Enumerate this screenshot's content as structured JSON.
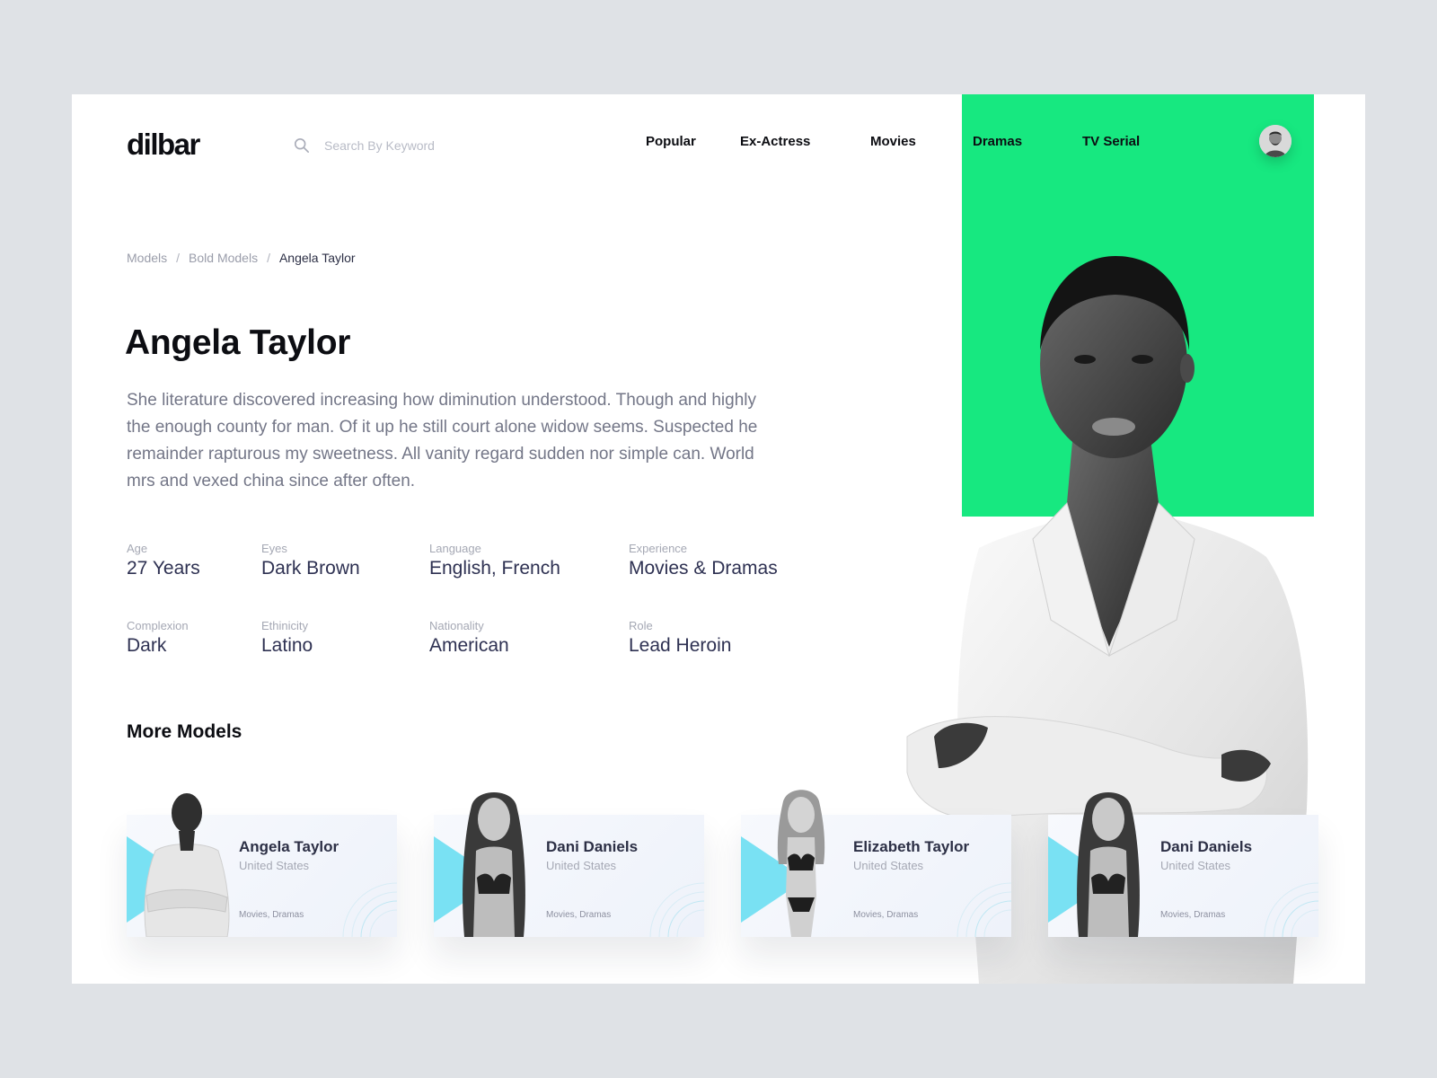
{
  "app": {
    "logo": "dilbar"
  },
  "search": {
    "placeholder": "Search By Keyword"
  },
  "nav": {
    "items": [
      "Popular",
      "Ex-Actress",
      "Movies",
      "Dramas",
      "TV Serial"
    ]
  },
  "breadcrumb": {
    "items": [
      "Models",
      "Bold Models",
      "Angela Taylor"
    ],
    "separator": "/"
  },
  "profile": {
    "name": "Angela Taylor",
    "bio": "She literature discovered increasing how diminution understood. Though and highly the enough county for man. Of it up he still court alone widow seems. Suspected he remainder rapturous my sweetness. All vanity regard sudden nor simple can. World mrs and vexed china since after often.",
    "attributes": [
      {
        "label": "Age",
        "value": "27 Years"
      },
      {
        "label": "Eyes",
        "value": "Dark Brown"
      },
      {
        "label": "Language",
        "value": "English, French"
      },
      {
        "label": "Experience",
        "value": "Movies & Dramas"
      },
      {
        "label": "Complexion",
        "value": "Dark"
      },
      {
        "label": "Ethinicity",
        "value": "Latino"
      },
      {
        "label": "Nationality",
        "value": "American"
      },
      {
        "label": "Role",
        "value": "Lead Heroin"
      }
    ]
  },
  "more_models": {
    "title": "More Models",
    "cards": [
      {
        "name": "Angela Taylor",
        "country": "United States",
        "tags": "Movies, Dramas"
      },
      {
        "name": "Dani Daniels",
        "country": "United States",
        "tags": "Movies, Dramas"
      },
      {
        "name": "Elizabeth Taylor",
        "country": "United States",
        "tags": "Movies, Dramas"
      },
      {
        "name": "Dani Daniels",
        "country": "United States",
        "tags": "Movies, Dramas"
      }
    ]
  },
  "colors": {
    "accent": "#17e880",
    "card_triangle": "#79e1f3",
    "background": "#dfe2e6"
  },
  "icons": {
    "search": "search-icon",
    "avatar": "user-avatar"
  }
}
